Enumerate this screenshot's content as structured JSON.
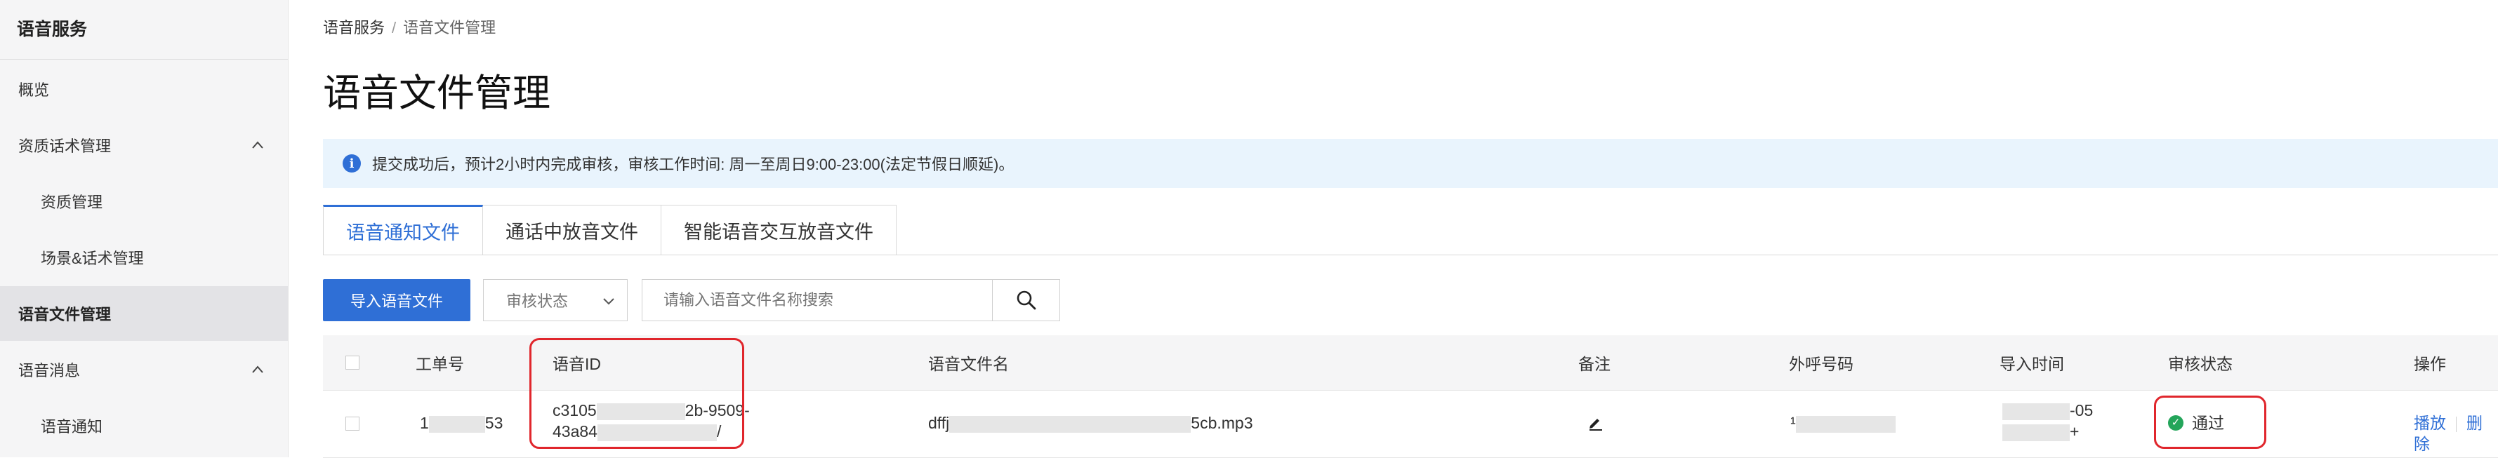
{
  "sidebar": {
    "title": "语音服务",
    "items": [
      {
        "label": "概览",
        "sub": false,
        "active": false
      },
      {
        "label": "资质话术管理",
        "sub": false,
        "active": false,
        "expanded": true
      },
      {
        "label": "资质管理",
        "sub": true,
        "active": false
      },
      {
        "label": "场景&话术管理",
        "sub": true,
        "active": false
      },
      {
        "label": "语音文件管理",
        "sub": false,
        "active": true
      },
      {
        "label": "语音消息",
        "sub": false,
        "active": false,
        "expanded": true
      },
      {
        "label": "语音通知",
        "sub": true,
        "active": false
      }
    ]
  },
  "breadcrumb": {
    "root": "语音服务",
    "separator": "/",
    "current": "语音文件管理"
  },
  "page_title": "语音文件管理",
  "notice": {
    "icon": "info-icon",
    "text": "提交成功后，预计2小时内完成审核，审核工作时间: 周一至周日9:00-23:00(法定节假日顺延)。"
  },
  "tabs": [
    {
      "label": "语音通知文件",
      "active": true
    },
    {
      "label": "通话中放音文件",
      "active": false
    },
    {
      "label": "智能语音交互放音文件",
      "active": false
    }
  ],
  "toolbar": {
    "import_label": "导入语音文件",
    "status_select": "审核状态",
    "search_placeholder": "请输入语音文件名称搜索",
    "search_icon": "search-icon"
  },
  "table": {
    "headers": [
      "工单号",
      "语音ID",
      "语音文件名",
      "备注",
      "外呼号码",
      "导入时间",
      "审核状态",
      "操作"
    ],
    "rows": [
      {
        "ticket_a": "1",
        "ticket_b": "53",
        "voice_id_l1_a": "c3105",
        "voice_id_l1_b": "2b-9509-",
        "voice_id_l2_a": "43a84",
        "voice_id_l2_b": "/",
        "file_a": "dffj",
        "file_b": "5cb.mp3",
        "remark_icon": "edit-icon",
        "caller_a": "¹",
        "import_a": "-05",
        "import_b": "+",
        "status": "通过",
        "status_icon": "check-circle-icon",
        "actions": [
          "播放",
          "删除"
        ]
      }
    ]
  },
  "colors": {
    "accent": "#2f6fd6",
    "highlight": "#e0262c",
    "success": "#23a55a"
  }
}
